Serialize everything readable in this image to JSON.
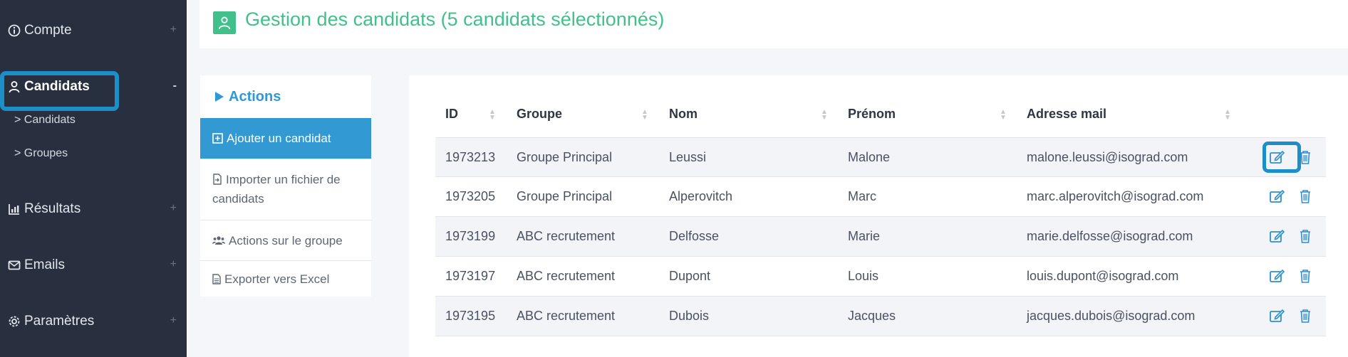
{
  "sidebar": {
    "items": [
      {
        "label": "Compte",
        "toggle": "+"
      },
      {
        "label": "Candidats",
        "toggle": "-"
      },
      {
        "label": "Résultats",
        "toggle": "+"
      },
      {
        "label": "Emails",
        "toggle": "+"
      },
      {
        "label": "Paramètres",
        "toggle": "+"
      }
    ],
    "subitems": [
      "> Candidats",
      "> Groupes"
    ]
  },
  "header": {
    "title": "Gestion des candidats (5 candidats sélectionnés)"
  },
  "actions": {
    "title": "Actions",
    "items": [
      "Ajouter un candidat",
      "Importer un fichier de candidats",
      "Actions sur le groupe",
      "Exporter vers Excel"
    ]
  },
  "table": {
    "columns": [
      "ID",
      "Groupe",
      "Nom",
      "Prénom",
      "Adresse mail"
    ],
    "rows": [
      {
        "id": "1973213",
        "groupe": "Groupe Principal",
        "nom": "Leussi",
        "prenom": "Malone",
        "email": "malone.leussi@isograd.com"
      },
      {
        "id": "1973205",
        "groupe": "Groupe Principal",
        "nom": "Alperovitch",
        "prenom": "Marc",
        "email": "marc.alperovitch@isograd.com"
      },
      {
        "id": "1973199",
        "groupe": "ABC recrutement",
        "nom": "Delfosse",
        "prenom": "Marie",
        "email": "marie.delfosse@isograd.com"
      },
      {
        "id": "1973197",
        "groupe": "ABC recrutement",
        "nom": "Dupont",
        "prenom": "Louis",
        "email": "louis.dupont@isograd.com"
      },
      {
        "id": "1973195",
        "groupe": "ABC recrutement",
        "nom": "Dubois",
        "prenom": "Jacques",
        "email": "jacques.dubois@isograd.com"
      }
    ]
  },
  "colors": {
    "sidebar_bg": "#28303f",
    "accent_green": "#41c08c",
    "accent_blue": "#3399d3",
    "highlight": "#1c8fc9"
  }
}
